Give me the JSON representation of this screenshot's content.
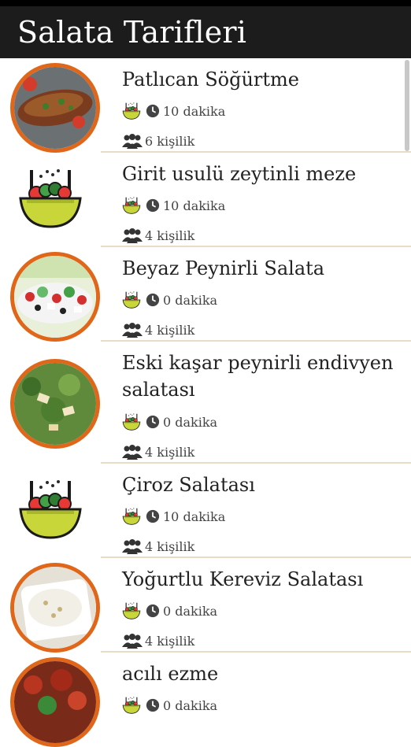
{
  "app_bar": {
    "title": "Salata Tarifleri"
  },
  "recipes": [
    {
      "title": "Patlıcan Söğürtme",
      "time": "10 dakika",
      "servings": "6 kişilik",
      "image": "eggplant-dish-photo"
    },
    {
      "title": "Girit usulü zeytinli meze",
      "time": "10 dakika",
      "servings": "4 kişilik",
      "image": "salad-bowl-icon"
    },
    {
      "title": "Beyaz Peynirli Salata",
      "time": "0 dakika",
      "servings": "4 kişilik",
      "image": "feta-salad-photo"
    },
    {
      "title": "Eski kaşar peynirli endivyen salatası",
      "time": "0 dakika",
      "servings": "4 kişilik",
      "image": "endive-salad-photo"
    },
    {
      "title": "Çiroz Salatası",
      "time": "10 dakika",
      "servings": "4 kişilik",
      "image": "salad-bowl-icon"
    },
    {
      "title": "Yoğurtlu Kereviz Salatası",
      "time": "0 dakika",
      "servings": "4 kişilik",
      "image": "yogurt-celery-photo"
    },
    {
      "title": "acılı ezme",
      "time": "0 dakika",
      "servings": "",
      "image": "spicy-ezme-photo"
    }
  ],
  "colors": {
    "app_bar": "#1c1c1c",
    "thumb_ring": "#e0661a",
    "divider": "#e8dcc8",
    "bowl_yellow": "#c8d63a"
  }
}
